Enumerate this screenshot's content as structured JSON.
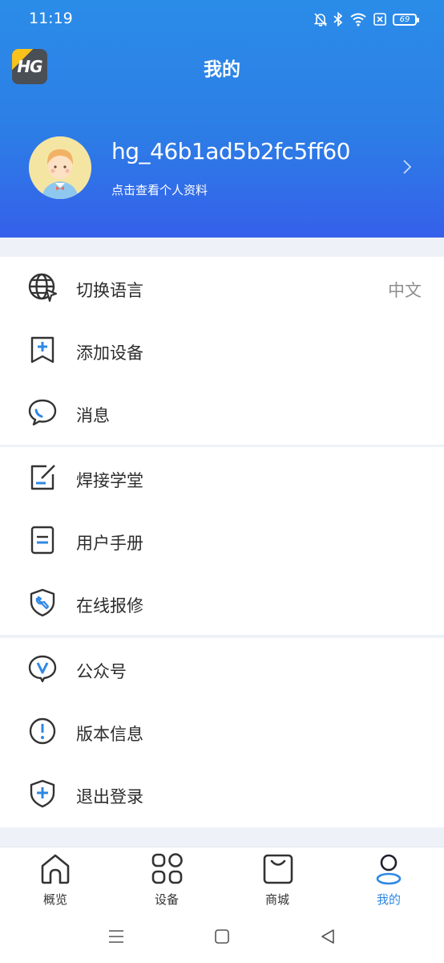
{
  "status_bar": {
    "time": "11:19",
    "battery": "69",
    "icons": [
      "bell-mute-icon",
      "bluetooth-icon",
      "wifi-icon",
      "sim-x-icon",
      "battery-icon"
    ]
  },
  "header": {
    "logo_text": "HG",
    "title": "我的"
  },
  "profile": {
    "username": "hg_46b1ad5b2fc5ff60",
    "subtitle": "点击查看个人资料"
  },
  "menu": {
    "group1": [
      {
        "label": "切换语言",
        "value": "中文",
        "icon": "globe-icon"
      },
      {
        "label": "添加设备",
        "icon": "bookmark-plus-icon"
      },
      {
        "label": "消息",
        "icon": "message-bubble-icon"
      }
    ],
    "group2": [
      {
        "label": "焊接学堂",
        "icon": "edit-square-icon"
      },
      {
        "label": "用户手册",
        "icon": "manual-icon"
      },
      {
        "label": "在线报修",
        "icon": "wrench-shield-icon"
      }
    ],
    "group3": [
      {
        "label": "公众号",
        "icon": "v-bubble-icon"
      },
      {
        "label": "版本信息",
        "icon": "info-circle-icon"
      },
      {
        "label": "退出登录",
        "icon": "shield-plus-icon"
      }
    ]
  },
  "tabbar": {
    "tabs": [
      {
        "label": "概览",
        "icon": "home-icon"
      },
      {
        "label": "设备",
        "icon": "devices-grid-icon"
      },
      {
        "label": "商城",
        "icon": "shopping-bag-icon"
      },
      {
        "label": "我的",
        "icon": "person-icon",
        "active": true
      }
    ]
  },
  "colors": {
    "header_top": "#2b8ce8",
    "header_bottom": "#3560ea",
    "accent": "#2f88e4",
    "icon_dark": "#333333"
  }
}
